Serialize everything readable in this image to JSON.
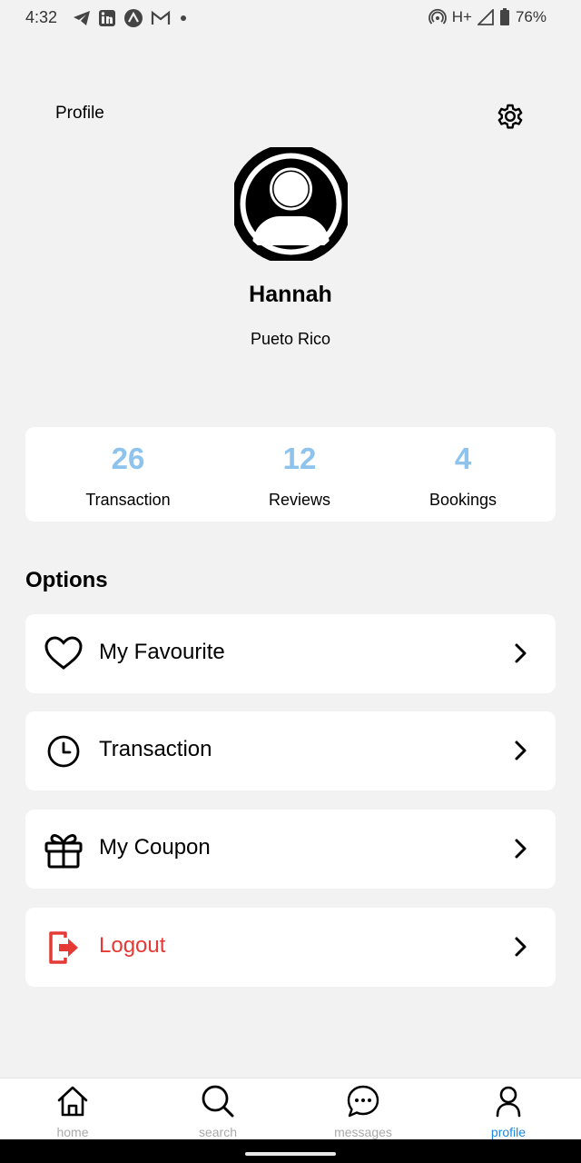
{
  "status_bar": {
    "time": "4:32",
    "network": "H+",
    "battery": "76%",
    "icons": [
      "telegram-icon",
      "linkedin-icon",
      "app-icon",
      "gmail-icon",
      "dot-icon",
      "hotspot-icon",
      "signal-icon",
      "battery-icon"
    ]
  },
  "header": {
    "title": "Profile",
    "settings_icon": "gear-icon"
  },
  "user": {
    "name": "Hannah",
    "location": "Pueto Rico",
    "avatar_icon": "user-avatar-icon"
  },
  "stats": [
    {
      "value": "26",
      "label": "Transaction"
    },
    {
      "value": "12",
      "label": "Reviews"
    },
    {
      "value": "4",
      "label": "Bookings"
    }
  ],
  "options": {
    "heading": "Options",
    "items": [
      {
        "label": "My Favourite",
        "icon": "heart-icon"
      },
      {
        "label": "Transaction",
        "icon": "clock-icon"
      },
      {
        "label": "My Coupon",
        "icon": "gift-icon"
      },
      {
        "label": "Logout",
        "icon": "logout-icon"
      }
    ]
  },
  "bottom_nav": {
    "items": [
      {
        "label": "home",
        "icon": "home-icon"
      },
      {
        "label": "search",
        "icon": "search-icon"
      },
      {
        "label": "messages",
        "icon": "chat-icon"
      },
      {
        "label": "profile",
        "icon": "user-icon",
        "active": true
      }
    ]
  },
  "colors": {
    "background": "#f2f2f2",
    "stat_value": "#8ec3ee",
    "logout": "#e53935",
    "active_nav": "#1e88e5",
    "inactive_nav": "#aaaaaa"
  }
}
